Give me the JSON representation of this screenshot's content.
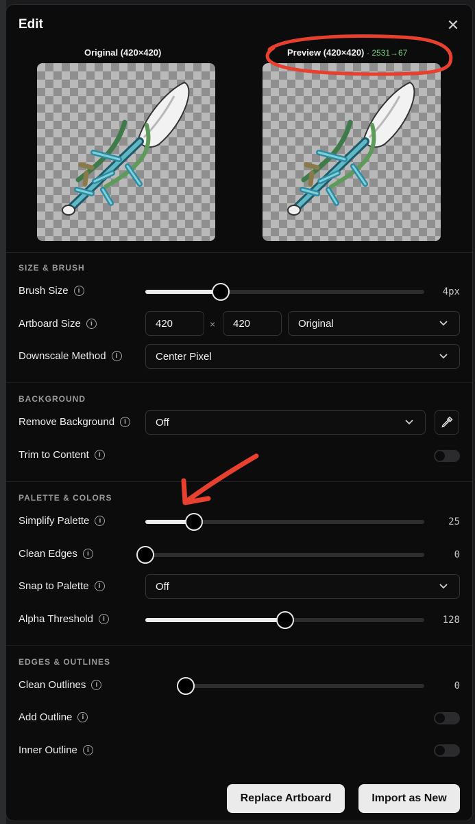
{
  "dialog": {
    "title": "Edit"
  },
  "images": {
    "original_label": "Original (420×420)",
    "preview_label": "Preview (420×420)",
    "preview_stat": "· 2531→67"
  },
  "sections": {
    "size_brush": "SIZE & BRUSH",
    "background": "BACKGROUND",
    "palette": "PALETTE & COLORS",
    "edges": "EDGES & OUTLINES"
  },
  "brush_size": {
    "label": "Brush Size",
    "value": "4px",
    "level": 0.27
  },
  "artboard_size": {
    "label": "Artboard Size",
    "width": "420",
    "times": "×",
    "height": "420",
    "preset": "Original"
  },
  "downscale": {
    "label": "Downscale Method",
    "value": "Center Pixel"
  },
  "remove_bg": {
    "label": "Remove Background",
    "value": "Off"
  },
  "trim": {
    "label": "Trim to Content",
    "on": false
  },
  "simplify": {
    "label": "Simplify Palette",
    "value": "25",
    "level": 0.175
  },
  "clean_edges": {
    "label": "Clean Edges",
    "value": "0",
    "level": 0.0
  },
  "snap": {
    "label": "Snap to Palette",
    "value": "Off"
  },
  "alpha": {
    "label": "Alpha Threshold",
    "value": "128",
    "level": 0.5
  },
  "clean_outlines": {
    "label": "Clean Outlines",
    "value": "0",
    "level": 0.0
  },
  "add_outline": {
    "label": "Add Outline",
    "on": false
  },
  "inner_outline": {
    "label": "Inner Outline",
    "on": false
  },
  "buttons": {
    "replace": "Replace Artboard",
    "import": "Import as New"
  },
  "info_glyph": "i",
  "colors": {
    "annotation": "#e8402e",
    "stat": "#6fd07a",
    "button": "#ebebeb"
  }
}
